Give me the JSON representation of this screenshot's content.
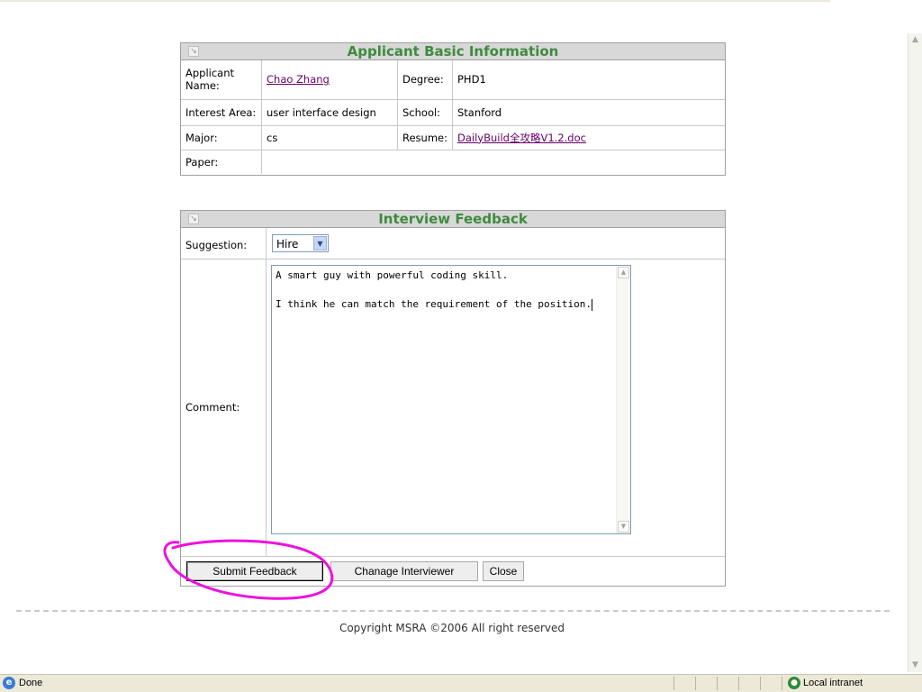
{
  "applicant_section": {
    "title": "Applicant Basic Information",
    "rows": [
      {
        "label1": "Applicant Name:",
        "value1": "Chao Zhang",
        "label2": "Degree:",
        "value2": "PHD1"
      },
      {
        "label1": "Interest Area:",
        "value1": "user interface design",
        "label2": "School:",
        "value2": "Stanford"
      },
      {
        "label1": "Major:",
        "value1": "cs",
        "label2": "Resume:",
        "value2": "DailyBuild全攻略V1.2.doc"
      },
      {
        "label1": "Paper:",
        "value1": ""
      }
    ]
  },
  "feedback_section": {
    "title": "Interview Feedback",
    "suggestion_label": "Suggestion:",
    "suggestion_value": "Hire",
    "comment_label": "Comment:",
    "comment_text": "A smart guy with powerful coding skill.\n\nI think he can match the requirement of the position."
  },
  "buttons": {
    "submit": "Submit Feedback",
    "change": "Chanage Interviewer",
    "close": "Close"
  },
  "footer": {
    "copyright": "Copyright MSRA ©2006 All right reserved"
  },
  "statusbar": {
    "status": "Done",
    "zone": "Local intranet"
  },
  "colors": {
    "section_title": "#3f8a3f",
    "link": "#660066",
    "annotation": "#ee11dd"
  }
}
